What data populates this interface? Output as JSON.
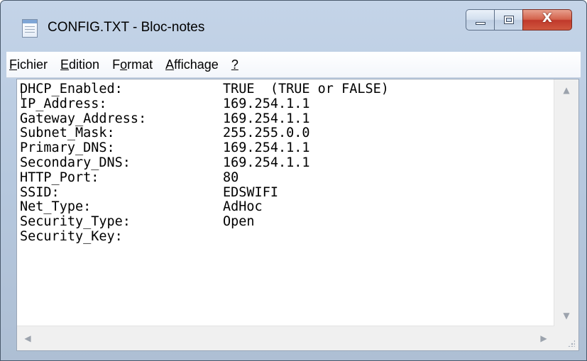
{
  "window": {
    "title": "CONFIG.TXT - Bloc-notes",
    "icon": "notepad-icon",
    "close_glyph": "X"
  },
  "menubar": {
    "items": [
      {
        "label": "Fichier",
        "mnemonic": "F"
      },
      {
        "label": "Edition",
        "mnemonic": "E"
      },
      {
        "label": "Format",
        "mnemonic": "o"
      },
      {
        "label": "Affichage",
        "mnemonic": "A"
      },
      {
        "label": "?",
        "mnemonic": "?"
      }
    ]
  },
  "document": {
    "lines": [
      {
        "key": "DHCP_Enabled:",
        "value": "TRUE  (TRUE or FALSE)"
      },
      {
        "key": "IP_Address:",
        "value": "169.254.1.1"
      },
      {
        "key": "Gateway_Address:",
        "value": "169.254.1.1"
      },
      {
        "key": "Subnet_Mask:",
        "value": "255.255.0.0"
      },
      {
        "key": "Primary_DNS:",
        "value": "169.254.1.1"
      },
      {
        "key": "Secondary_DNS:",
        "value": "169.254.1.1"
      },
      {
        "key": "HTTP_Port:",
        "value": "80"
      },
      {
        "key": "SSID:",
        "value": "EDSWIFI"
      },
      {
        "key": "Net_Type:",
        "value": "AdHoc"
      },
      {
        "key": "Security_Type:",
        "value": "Open"
      },
      {
        "key": "Security_Key:",
        "value": ""
      }
    ]
  },
  "colors": {
    "titlebar": "#b6c8de",
    "close_button": "#c0392b",
    "editor_background": "#ffffff"
  }
}
